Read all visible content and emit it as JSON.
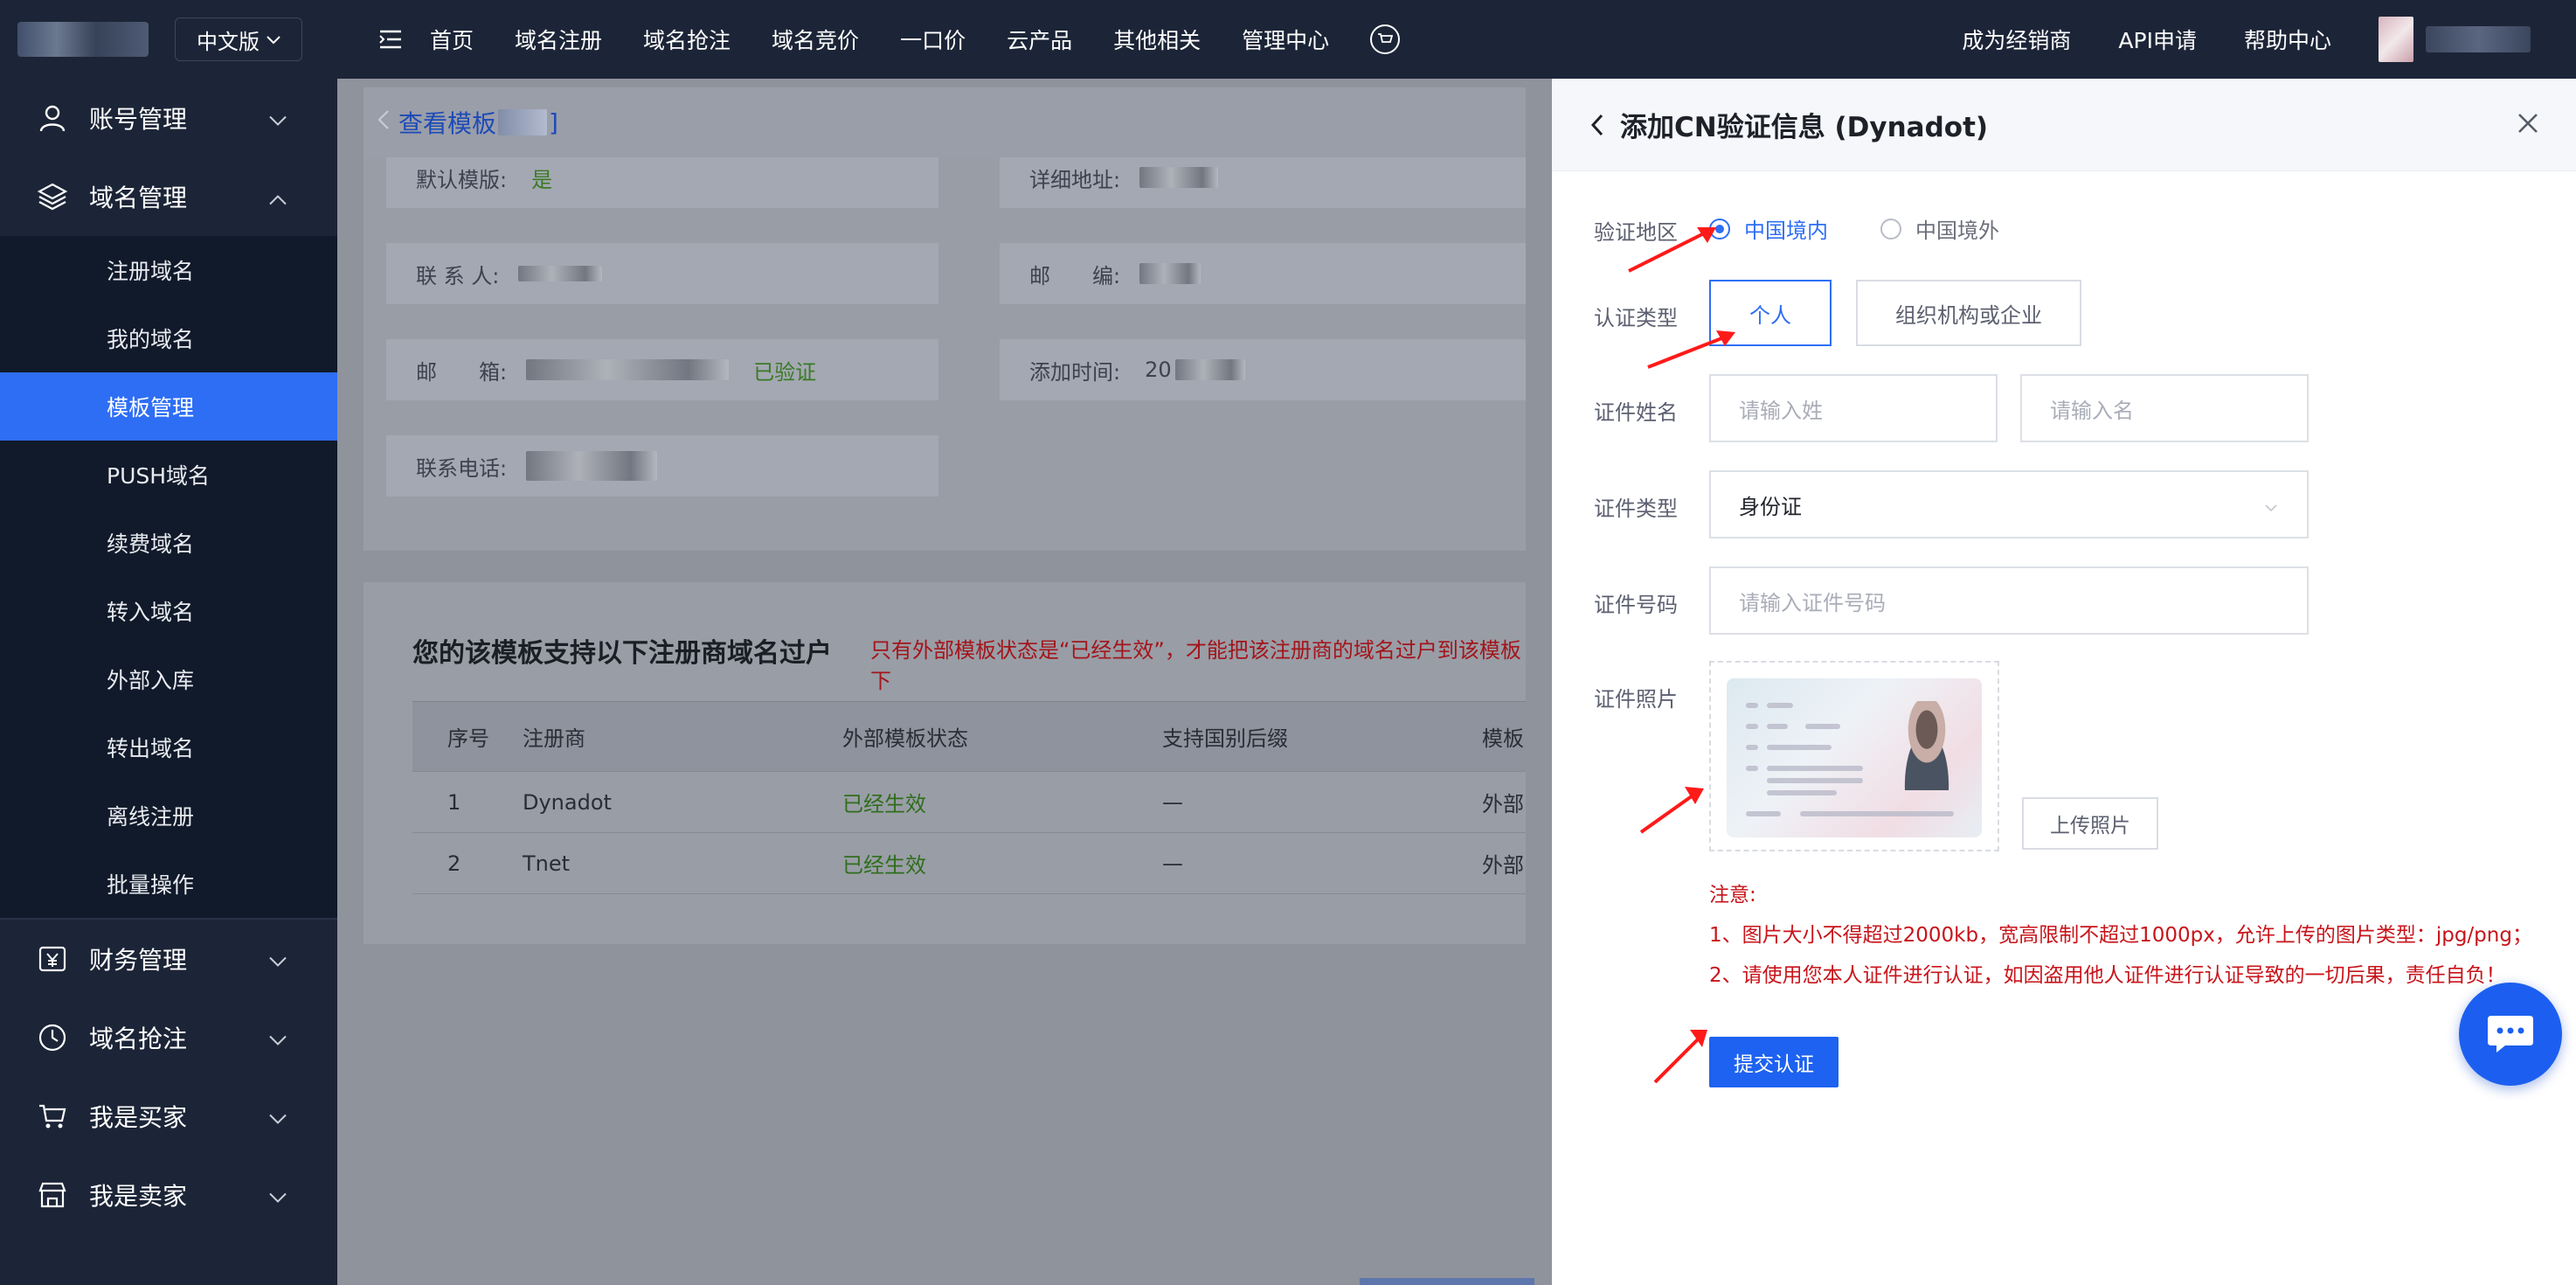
{
  "sidebar": {
    "lang": "中文版",
    "groups": [
      {
        "label": "账号管理",
        "icon": "user-icon"
      },
      {
        "label": "域名管理",
        "icon": "layers-icon"
      }
    ],
    "submenu": [
      {
        "label": "注册域名"
      },
      {
        "label": "我的域名"
      },
      {
        "label": "模板管理"
      },
      {
        "label": "PUSH域名"
      },
      {
        "label": "续费域名"
      },
      {
        "label": "转入域名"
      },
      {
        "label": "外部入库"
      },
      {
        "label": "转出域名"
      },
      {
        "label": "离线注册"
      },
      {
        "label": "批量操作"
      }
    ],
    "groups_after": [
      {
        "label": "财务管理",
        "icon": "yen-icon"
      },
      {
        "label": "域名抢注",
        "icon": "clock-icon"
      },
      {
        "label": "我是买家",
        "icon": "cart-icon"
      },
      {
        "label": "我是卖家",
        "icon": "store-icon"
      }
    ],
    "active_color": "#2e6ef5"
  },
  "topbar": {
    "items": [
      "首页",
      "域名注册",
      "域名抢注",
      "域名竞价",
      "一口价",
      "云产品",
      "其他相关",
      "管理中心"
    ],
    "right": [
      "成为经销商",
      "API申请",
      "帮助中心"
    ]
  },
  "main": {
    "header_title": "查看模板",
    "header_suffix": "]",
    "info": {
      "default_label": "默认模版:",
      "default_value": "是",
      "address_label": "详细地址:",
      "contact_label": "联 系 人:",
      "zip_label": "邮　　编:",
      "email_label": "邮　　箱:",
      "email_status": "已验证",
      "added_label": "添加时间:",
      "added_prefix": "20",
      "phone_label": "联系电话:"
    },
    "support": {
      "title": "您的该模板支持以下注册商域名过户",
      "note": "只有外部模板状态是“已经生效”，才能把该注册商的域名过户到该模板下",
      "columns": [
        "序号",
        "注册商",
        "外部模板状态",
        "支持国别后缀",
        "模板"
      ],
      "rows": [
        {
          "no": "1",
          "registrar": "Dynadot",
          "status": "已经生效",
          "suffix": "—",
          "tpl": "外部"
        },
        {
          "no": "2",
          "registrar": "Tnet",
          "status": "已经生效",
          "suffix": "—",
          "tpl": "外部"
        }
      ]
    }
  },
  "drawer": {
    "title": "添加CN验证信息 (Dynadot)",
    "region_label": "验证地区",
    "region_options": [
      "中国境内",
      "中国境外"
    ],
    "type_label": "认证类型",
    "type_options": [
      "个人",
      "组织机构或企业"
    ],
    "name_label": "证件姓名",
    "surname_placeholder": "请输入姓",
    "given_placeholder": "请输入名",
    "idtype_label": "证件类型",
    "idtype_value": "身份证",
    "idno_label": "证件号码",
    "idno_placeholder": "请输入证件号码",
    "photo_label": "证件照片",
    "upload_label": "上传照片",
    "note_title": "注意:",
    "note_lines": [
      "1、图片大小不得超过2000kb，宽高限制不超过1000px，允许上传的图片类型：jpg/png；",
      "2、请使用您本人证件进行认证，如因盗用他人证件进行认证导致的一切后果，责任自负！"
    ],
    "submit_label": "提交认证",
    "accent": "#2e6ef5",
    "note_color": "#c8141b"
  }
}
